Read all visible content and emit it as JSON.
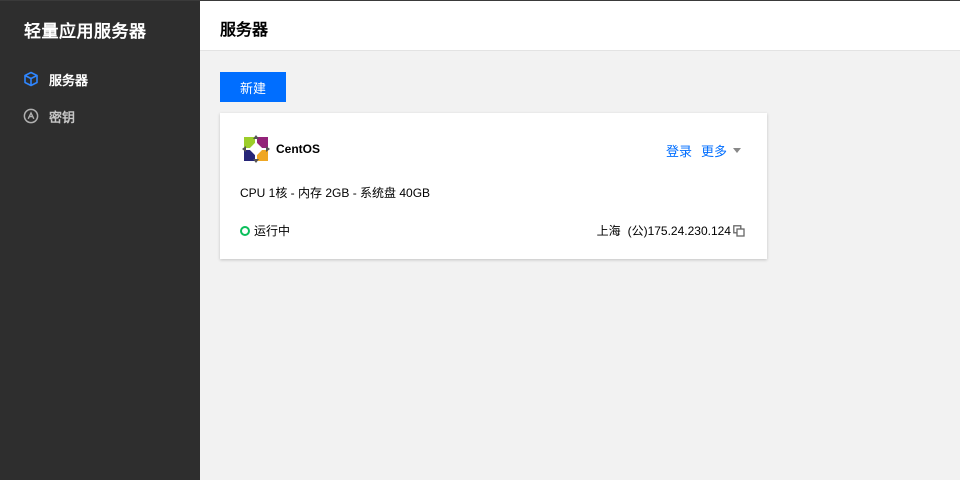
{
  "sidebar": {
    "title": "轻量应用服务器",
    "items": [
      {
        "label": "服务器",
        "icon": "cube-icon",
        "active": true
      },
      {
        "label": "密钥",
        "icon": "key-icon",
        "active": false
      }
    ]
  },
  "header": {
    "title": "服务器"
  },
  "toolbar": {
    "new_label": "新建"
  },
  "server_card": {
    "os_name": "CentOS",
    "login_label": "登录",
    "more_label": "更多",
    "spec": "CPU 1核 - 内存 2GB - 系统盘 40GB",
    "status": "运行中",
    "region": "上海",
    "ip": "(公)175.24.230.124"
  },
  "colors": {
    "accent": "#006eff",
    "sidebar_bg": "#2e2e2e",
    "page_bg": "#f2f2f2",
    "status_running": "#0abf5b"
  }
}
